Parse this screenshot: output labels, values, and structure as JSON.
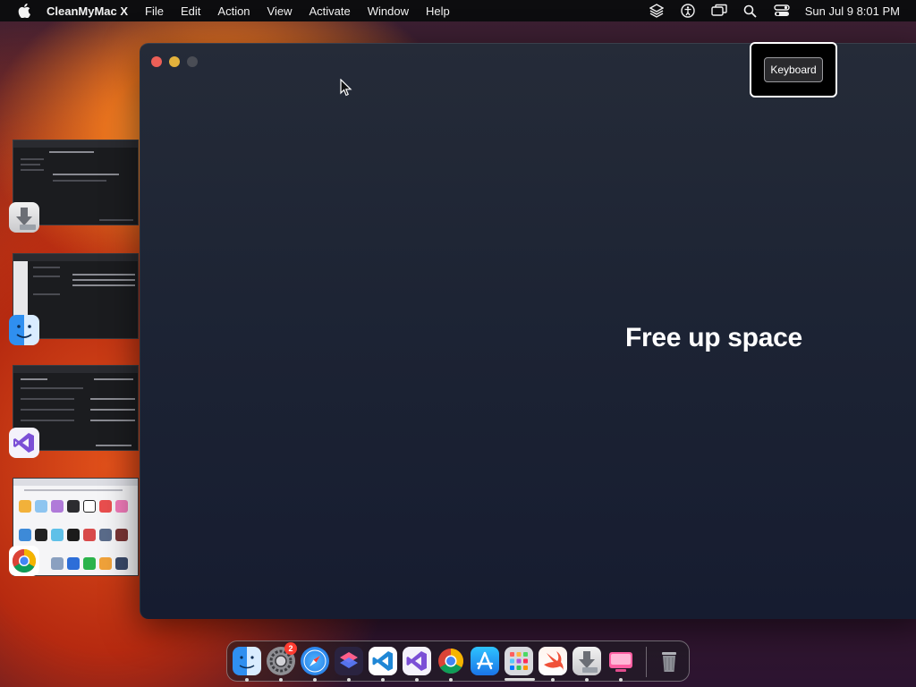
{
  "menubar": {
    "app_name": "CleanMyMac X",
    "menus": [
      "File",
      "Edit",
      "Action",
      "View",
      "Activate",
      "Window",
      "Help"
    ],
    "status_icons": [
      "layers-icon",
      "accessibility-icon",
      "screen-mirroring-icon",
      "spotlight-search-icon",
      "control-center-icon"
    ],
    "clock": "Sun Jul 9  8:01 PM"
  },
  "window": {
    "headline": "Free up space"
  },
  "overlay": {
    "keyboard_label": "Keyboard"
  },
  "stage_manager": {
    "apps": [
      "installer-app",
      "finder-app",
      "visual-studio-app",
      "chrome-app"
    ]
  },
  "dock": {
    "items": [
      {
        "name": "finder",
        "running": true
      },
      {
        "name": "system-settings",
        "running": true,
        "badge": "2"
      },
      {
        "name": "safari",
        "running": true
      },
      {
        "name": "shortcuts",
        "running": true
      },
      {
        "name": "vscode",
        "running": true
      },
      {
        "name": "visual-studio",
        "running": true
      },
      {
        "name": "chrome",
        "running": true
      },
      {
        "name": "app-store",
        "running": false
      },
      {
        "name": "launchpad",
        "running": false
      },
      {
        "name": "swift-playgrounds",
        "running": true
      },
      {
        "name": "installer",
        "running": true
      },
      {
        "name": "cleanmymac",
        "running": true
      },
      {
        "name": "trash",
        "running": false
      }
    ]
  },
  "colors": {
    "menubar_bg": "#0d0d0f",
    "window_bg": "#1d2434",
    "close": "#ec5f57",
    "minimize": "#e3b23c",
    "badge": "#ff3b30"
  }
}
